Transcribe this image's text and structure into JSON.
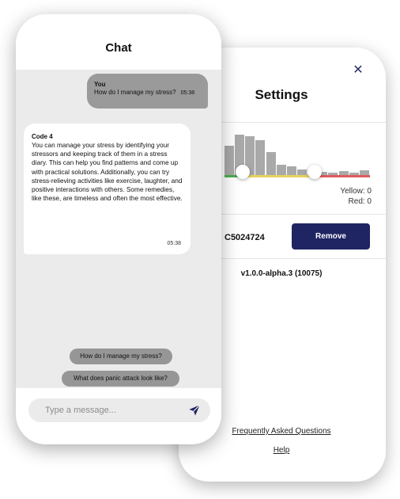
{
  "settings": {
    "title": "Settings",
    "close_icon": "close-icon",
    "histogram_values": [
      42,
      58,
      56,
      50,
      33,
      16,
      13,
      9,
      9,
      6,
      5,
      7,
      5,
      8
    ],
    "counts": {
      "yellow": "Yellow: 0",
      "red": "Red: 0"
    },
    "device_id": "C5024724",
    "remove_label": "Remove",
    "version": "v1.0.0-alpha.3 (10075)",
    "faq_label": "Frequently Asked Questions",
    "help_label": "Help",
    "colors": {
      "button": "#1f2462",
      "green": "#4caf50",
      "yellow": "#e6d25c",
      "red": "#e05a5a"
    }
  },
  "chat": {
    "title": "Chat",
    "messages": [
      {
        "sender": "You",
        "text": "How do I manage my stress?",
        "time": "05:38"
      },
      {
        "sender": "Code 4",
        "text": " You can manage your stress by identifying your stressors and keeping track of them in a stress diary. This can help you find patterns and come up with practical solutions. Additionally, you can try stress-relieving activities like exercise, laughter, and positive interactions with others. Some remedies, like these, are timeless and often the most effective.",
        "time": "05:38"
      }
    ],
    "suggestions": [
      "How do I manage my stress?",
      "What does panic attack look like?"
    ],
    "input": {
      "value": "",
      "placeholder": "Type a message..."
    },
    "send_icon": "send-icon"
  }
}
